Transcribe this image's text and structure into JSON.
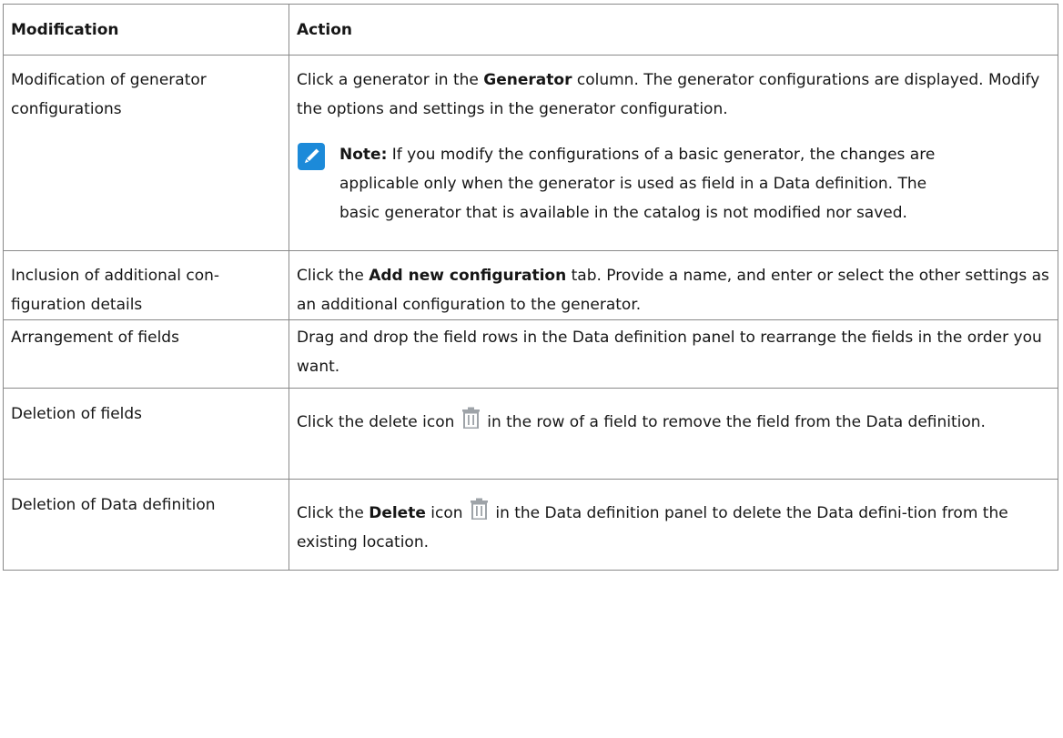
{
  "table": {
    "header": {
      "modification": "Modification",
      "action": "Action"
    },
    "rows": [
      {
        "modification": "Modification of generator configurations",
        "action_prefix": "Click a generator in the ",
        "action_bold": "Generator",
        "action_suffix": " column. The generator configurations are displayed. Modify the options and settings in the generator configuration.",
        "note_label": "Note:",
        "note_text": " If you modify the configurations of a basic generator, the changes are applicable only when the generator is used as field in a Data definition. The basic generator that is available in the catalog is not modified nor saved."
      },
      {
        "modification": "Inclusion of additional con-figuration details",
        "action_prefix": "Click the ",
        "action_bold": "Add new configuration",
        "action_suffix": " tab. Provide a name, and enter or select the other settings as an additional configuration to the generator."
      },
      {
        "modification": "Arrangement of fields",
        "action": "Drag and drop the field rows in the Data definition panel to rearrange the fields in the order you want."
      },
      {
        "modification": "Deletion of fields",
        "action_prefix": "Click the delete icon ",
        "action_suffix": " in the row of a field to remove the field from the Data definition."
      },
      {
        "modification": "Deletion of Data definition",
        "action_prefix": "Click the ",
        "action_bold": "Delete",
        "action_middle": " icon ",
        "action_suffix": " in the Data definition panel to delete the Data defini-tion from the existing location."
      }
    ]
  },
  "icons": {
    "note": "pencil-note-icon",
    "delete": "trash-can-icon"
  },
  "colors": {
    "note_icon_bg": "#1c8ad9",
    "trash_icon": "#9ea3a8",
    "border": "#8a8a8a"
  }
}
